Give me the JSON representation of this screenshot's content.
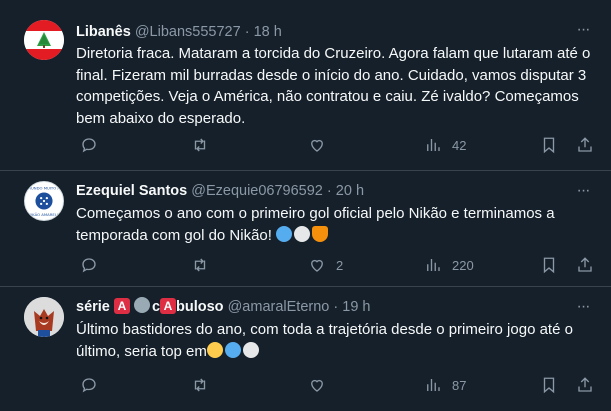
{
  "tweets": [
    {
      "name": "Libanês",
      "handle": "@Libans555727",
      "dot": "·",
      "time": "18 h",
      "text": "Diretoria fraca. Mataram a torcida do Cruzeiro. Agora falam que lutaram até o final. Fizeram mil burradas desde o início do ano. Cuidado, vamos disputar 3 competições. Veja o América, não contratou e caiu. Zé ivaldo? Começamos bem abaixo do esperado.",
      "replies": "",
      "retweets": "",
      "likes": "",
      "views": "42",
      "avatar_icon": "lebanon-flag-icon"
    },
    {
      "name": "Ezequiel Santos",
      "handle": "@Ezequie06796592",
      "dot": "·",
      "time": "20 h",
      "text": "Começamos o ano com o primeiro gol oficial pelo Nikão e terminamos a temporada com gol do Nikão!",
      "replies": "",
      "retweets": "",
      "likes": "2",
      "views": "220",
      "avatar_icon": "cruzeiro-badge-icon",
      "avatar_text": "UM MUNDO MUITO AZUL NIKÃO AMARELO"
    },
    {
      "name_part1": "série",
      "name_letter1": "A",
      "name_part2": "c",
      "name_letter2": "A",
      "name_part3": "buloso",
      "handle": "@amaralEterno",
      "dot": "·",
      "time": "19 h",
      "text": "Último bastidores do ano, com toda a trajetória desde o primeiro jogo até o último, seria top em",
      "replies": "",
      "retweets": "",
      "likes": "",
      "views": "87",
      "avatar_icon": "fox-mascot-icon"
    }
  ],
  "colors": {
    "background": "#15202b",
    "divider": "#38444d",
    "secondary_text": "#8b98a5",
    "primary_text": "#f7f9f9"
  }
}
